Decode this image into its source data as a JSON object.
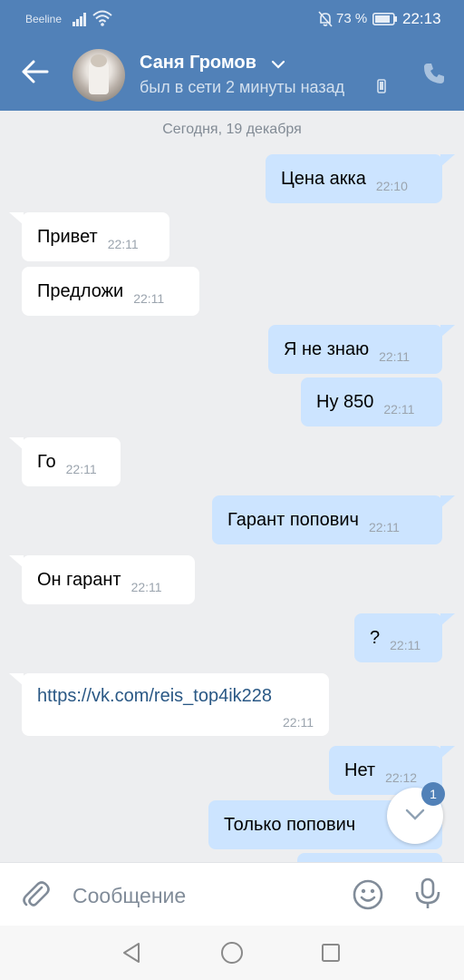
{
  "status_bar": {
    "carrier": "Beeline",
    "battery_percent": "73 %",
    "time": "22:13"
  },
  "header": {
    "contact_name": "Саня Громов",
    "presence": "был в сети 2 минуты назад"
  },
  "chat": {
    "date_separator": "Сегодня, 19 декабря",
    "messages": [
      {
        "direction": "out",
        "text": "Цена акка",
        "time": "22:10"
      },
      {
        "direction": "in",
        "text": "Привет",
        "time": "22:11"
      },
      {
        "direction": "in",
        "text": "Предложи",
        "time": "22:11"
      },
      {
        "direction": "out",
        "text": "Я не знаю",
        "time": "22:11"
      },
      {
        "direction": "out",
        "text": "Ну 850",
        "time": "22:11"
      },
      {
        "direction": "in",
        "text": "Го",
        "time": "22:11"
      },
      {
        "direction": "out",
        "text": "Гарант попович",
        "time": "22:11"
      },
      {
        "direction": "in",
        "text": "Он гарант",
        "time": "22:11"
      },
      {
        "direction": "out",
        "text": "?",
        "time": "22:11"
      },
      {
        "direction": "in",
        "text": "https://vk.com/reis_top4ik228",
        "time": "22:11"
      },
      {
        "direction": "out",
        "text": "Нет",
        "time": "22:12"
      },
      {
        "direction": "out",
        "text": "Только попович",
        "time": ""
      }
    ],
    "unread_count": "1"
  },
  "composer": {
    "placeholder": "Сообщение"
  },
  "icons": {
    "back": "arrow-left-icon",
    "chevron": "chevron-down-icon",
    "phone": "phone-icon",
    "attach": "paperclip-icon",
    "emoji": "smile-icon",
    "mic": "microphone-icon",
    "scroll_down": "chevron-down-icon"
  },
  "colors": {
    "header": "#5181b8",
    "outgoing_bubble": "#cce4ff",
    "incoming_bubble": "#ffffff",
    "link": "#2a5885",
    "background": "#edeef0"
  }
}
